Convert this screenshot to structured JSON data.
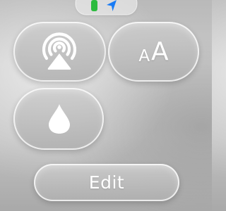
{
  "status_bar": {
    "battery_icon": "battery-charging-icon",
    "location_icon": "location-arrow-icon",
    "battery_color": "#2dbb3f",
    "location_color": "#1a7cf5"
  },
  "controls": {
    "airplay": {
      "icon": "airplay-icon"
    },
    "text_size": {
      "icon": "text-size-icon",
      "small_glyph": "A",
      "large_glyph": "A"
    },
    "water_lock": {
      "icon": "water-drop-icon"
    },
    "edit": {
      "label": "Edit"
    }
  }
}
